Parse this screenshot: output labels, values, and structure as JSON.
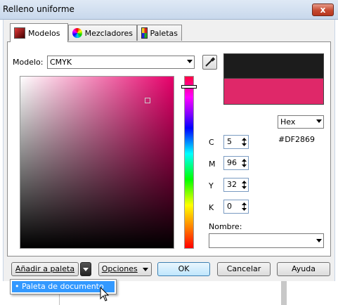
{
  "window": {
    "title": "Relleno uniforme",
    "close_label": "x"
  },
  "tabs": [
    {
      "label": "Modelos",
      "icon": "models-icon"
    },
    {
      "label": "Mezcladores",
      "icon": "mixers-icon"
    },
    {
      "label": "Paletas",
      "icon": "palettes-icon"
    }
  ],
  "model": {
    "label": "Modelo:",
    "value": "CMYK"
  },
  "hex": {
    "format": "Hex",
    "value": "#DF2869"
  },
  "cmyk": [
    {
      "label": "C",
      "value": "5"
    },
    {
      "label": "M",
      "value": "96"
    },
    {
      "label": "Y",
      "value": "32"
    },
    {
      "label": "K",
      "value": "0"
    }
  ],
  "name": {
    "label": "Nombre:",
    "value": ""
  },
  "buttons": {
    "add_palette": "Añadir a paleta",
    "options": "Opciones",
    "ok": "OK",
    "cancel": "Cancelar",
    "help": "Ayuda"
  },
  "dropdown_menu": {
    "item": "Paleta de documento"
  },
  "colors": {
    "old": "#1c1c1c",
    "new": "#df2869",
    "accent": "#3399ff"
  }
}
